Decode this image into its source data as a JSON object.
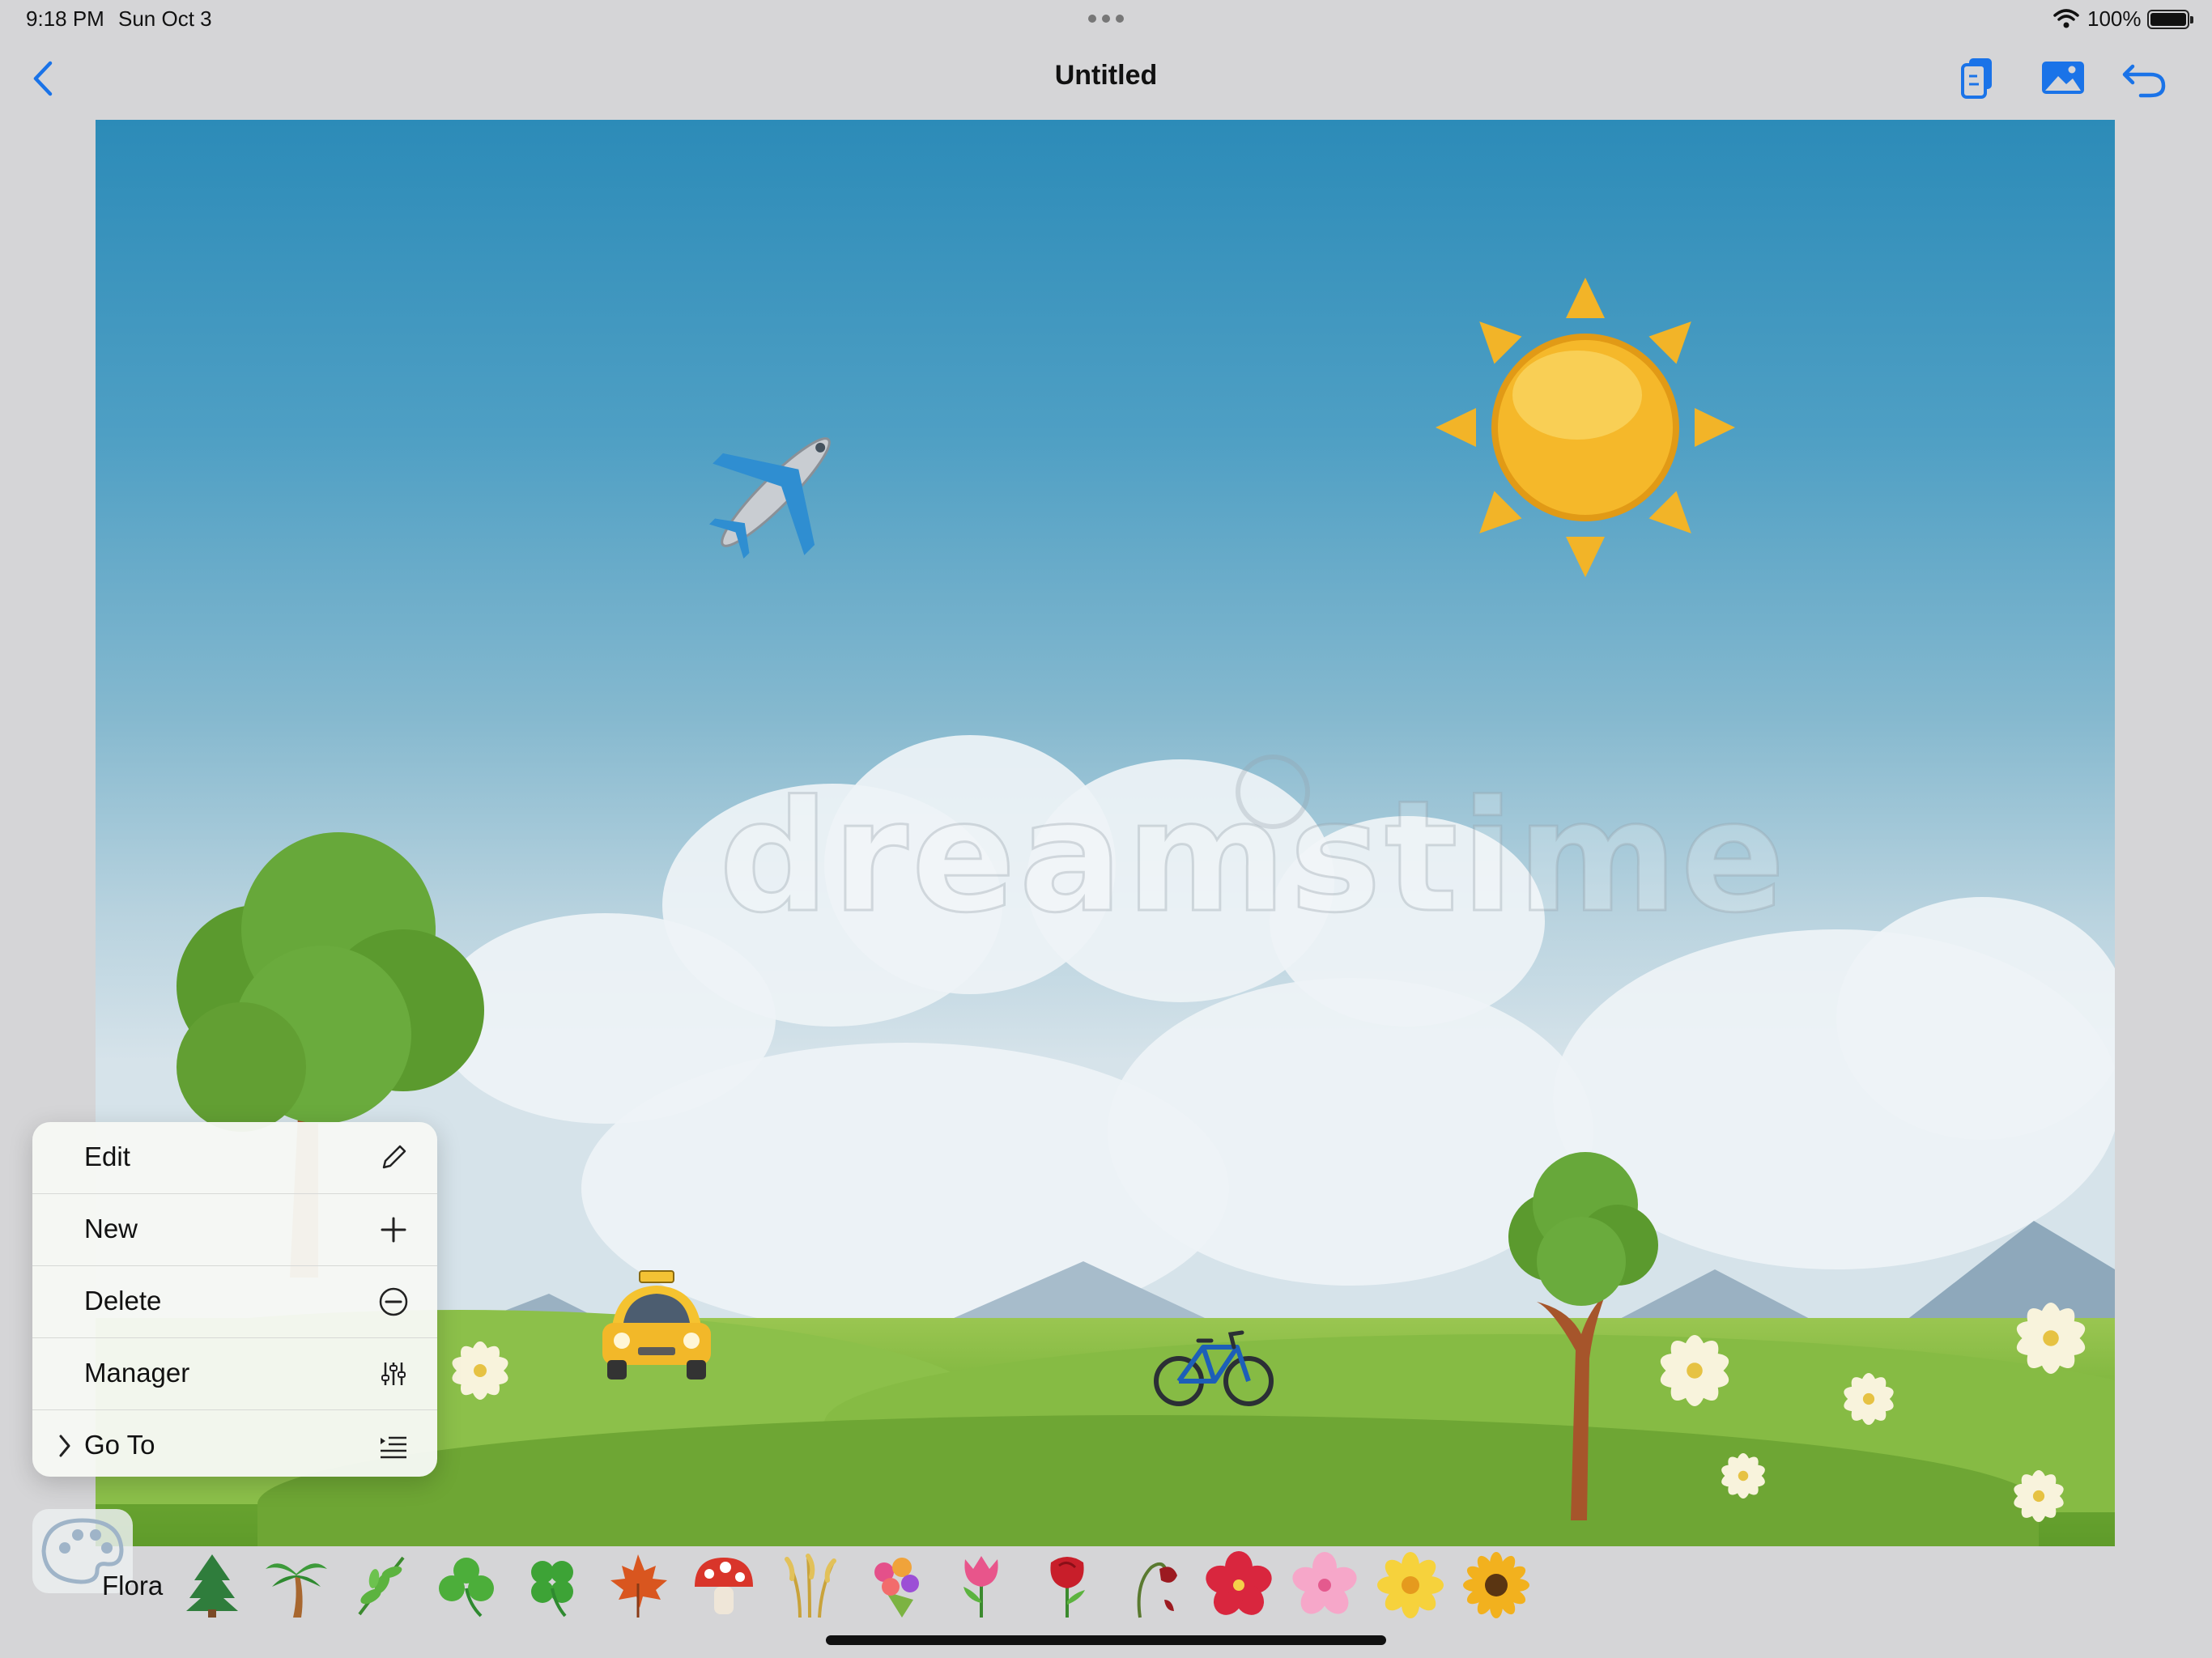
{
  "status_bar": {
    "time": "9:18 PM",
    "date": "Sun Oct 3",
    "battery": "100%",
    "icons": [
      "wifi-icon",
      "battery-icon",
      "multitask-dots-icon"
    ]
  },
  "nav": {
    "title": "Untitled",
    "icons": [
      "back-chevron-icon",
      "copy-icon",
      "photo-icon",
      "undo-icon"
    ]
  },
  "canvas": {
    "watermark": "dreamstime",
    "stickers": [
      "airplane",
      "sun",
      "taxi",
      "bicycle"
    ],
    "colors": {
      "sky_top": "#2c8bb8",
      "sky_bottom": "#d6e3ea",
      "grass": "#78b23a"
    }
  },
  "context_menu": {
    "items": [
      {
        "label": "Edit",
        "icon": "pencil-icon"
      },
      {
        "label": "New",
        "icon": "plus-icon"
      },
      {
        "label": "Delete",
        "icon": "minus-circle-icon"
      },
      {
        "label": "Manager",
        "icon": "sliders-icon"
      },
      {
        "label": "Go To",
        "icon": "list-indent-icon",
        "has_chevron": true
      }
    ]
  },
  "sticker_strip": {
    "category": "Flora",
    "items": [
      "evergreen-tree",
      "palm-tree",
      "herb",
      "shamrock",
      "four-leaf-clover",
      "maple-leaf",
      "mushroom",
      "sheaf-of-rice",
      "bouquet",
      "tulip",
      "rose",
      "wilted-flower",
      "hibiscus",
      "cherry-blossom",
      "blossom",
      "sunflower"
    ]
  }
}
